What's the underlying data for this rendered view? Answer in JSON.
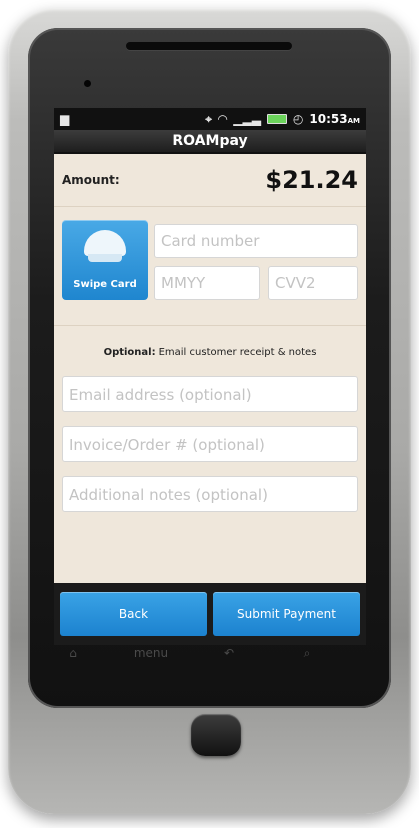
{
  "status": {
    "time": "10:53",
    "ampm": "AM",
    "icons": [
      "notification-icon",
      "gps-icon",
      "wifi-icon",
      "signal-icon",
      "battery-icon",
      "alarm-icon"
    ]
  },
  "app": {
    "title": "ROAMpay"
  },
  "amount": {
    "label": "Amount:",
    "value": "$21.24"
  },
  "card": {
    "swipe_label": "Swipe Card",
    "card_number_placeholder": "Card number",
    "expiry_placeholder": "MMYY",
    "cvv_placeholder": "CVV2"
  },
  "optional": {
    "bold": "Optional:",
    "text": "Email customer receipt & notes",
    "email_placeholder": "Email address (optional)",
    "invoice_placeholder": "Invoice/Order # (optional)",
    "notes_placeholder": "Additional notes (optional)"
  },
  "buttons": {
    "back": "Back",
    "submit": "Submit Payment"
  },
  "hardware_nav": {
    "home_icon": "home-icon",
    "menu": "menu",
    "back_icon": "back-icon",
    "search_icon": "search-icon"
  },
  "colors": {
    "accent": "#1f86cf",
    "screen_bg": "#efe7db",
    "status_bg": "#111111"
  }
}
